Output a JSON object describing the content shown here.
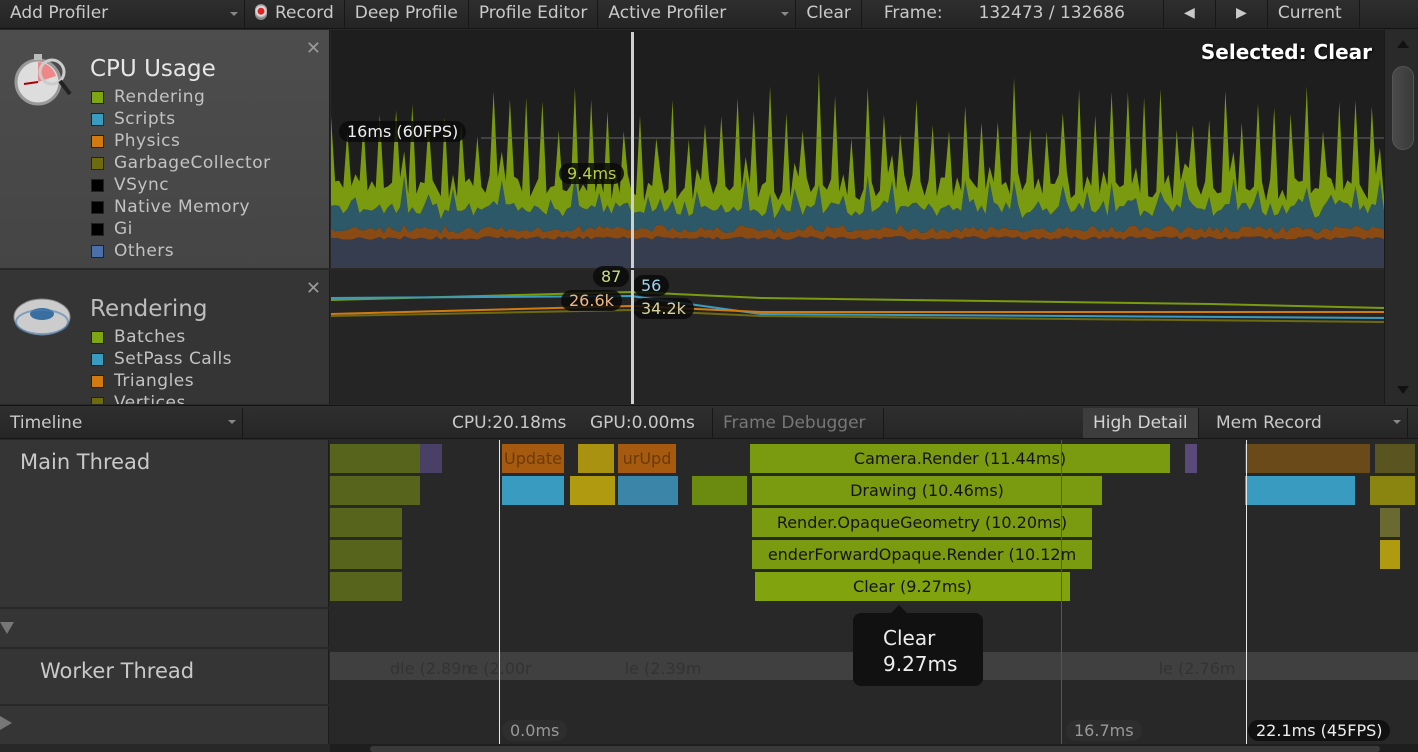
{
  "toolbar": {
    "add_profiler": "Add Profiler",
    "record": "Record",
    "deep_profile": "Deep Profile",
    "profile_editor": "Profile Editor",
    "active_profiler": "Active Profiler",
    "clear": "Clear",
    "frame_label": "Frame:",
    "frame_value": "132473 / 132686",
    "prev_icon": "◀",
    "next_icon": "▶",
    "current": "Current"
  },
  "cpu_panel": {
    "title": "CPU Usage",
    "close": "✕",
    "legend": [
      {
        "label": "Rendering",
        "color": "#7ea512"
      },
      {
        "label": "Scripts",
        "color": "#3a9bc0"
      },
      {
        "label": "Physics",
        "color": "#d17a0f"
      },
      {
        "label": "GarbageCollector",
        "color": "#6e6a10"
      },
      {
        "label": "VSync",
        "color": "#000000"
      },
      {
        "label": "Native Memory",
        "color": "#000000"
      },
      {
        "label": "Gi",
        "color": "#000000"
      },
      {
        "label": "Others",
        "color": "#4b6fa8"
      }
    ],
    "selected_label": "Selected: Clear",
    "target_label": "16ms (60FPS)",
    "value_label": "9.4ms"
  },
  "rendering_panel": {
    "title": "Rendering",
    "close": "✕",
    "legend": [
      {
        "label": "Batches",
        "color": "#7ea512"
      },
      {
        "label": "SetPass Calls",
        "color": "#3a9bc0"
      },
      {
        "label": "Triangles",
        "color": "#d17a0f"
      },
      {
        "label": "Vertices",
        "color": "#6e6a10"
      }
    ],
    "values": {
      "batches": "87",
      "setpass": "56",
      "triangles": "26.6k",
      "vertices": "34.2k"
    }
  },
  "timeline_toolbar": {
    "view_mode": "Timeline",
    "cpu": "CPU:20.18ms",
    "gpu": "GPU:0.00ms",
    "frame_debugger": "Frame Debugger",
    "high_detail": "High Detail",
    "mem_record": "Mem Record"
  },
  "threads": {
    "main": "Main Thread",
    "worker": "Worker Thread"
  },
  "timeline": {
    "bars": [
      {
        "label": "Camera.Render (11.44ms)"
      },
      {
        "label": "Drawing (10.46ms)"
      },
      {
        "label": "Render.OpaqueGeometry (10.20ms)"
      },
      {
        "label": "enderForwardOpaque.Render (10.12m"
      },
      {
        "label": "Clear (9.27ms)"
      }
    ],
    "update_labels": [
      "Update",
      "urUpd"
    ],
    "worker_labels": [
      "dle (2.89m",
      "e (2.00r",
      "le (2.39m",
      "le (2.76m"
    ],
    "markers": {
      "start": "0.0ms",
      "mid": "16.7ms",
      "end": "22.1ms (45FPS)"
    }
  },
  "tooltip": {
    "name": "Clear",
    "time": "9.27ms"
  }
}
